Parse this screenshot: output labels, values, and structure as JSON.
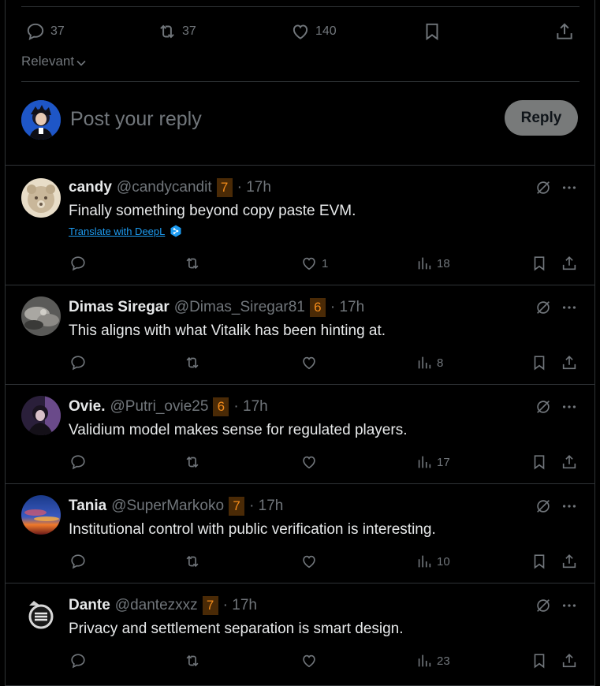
{
  "tweet_actions": {
    "reply_count": "37",
    "retweet_count": "37",
    "like_count": "140"
  },
  "sort": {
    "label": "Relevant"
  },
  "composer": {
    "placeholder": "Post your reply",
    "button_label": "Reply"
  },
  "replies": [
    {
      "name": "candy",
      "handle": "@candycandit",
      "badge": "7",
      "time": "· 17h",
      "text": "Finally something beyond copy paste EVM.",
      "translate": "Translate with DeepL",
      "likes": "1",
      "views": "18"
    },
    {
      "name": "Dimas Siregar",
      "handle": "@Dimas_Siregar81",
      "badge": "6",
      "time": "· 17h",
      "text": "This aligns with what Vitalik has been hinting at.",
      "likes": "",
      "views": "8"
    },
    {
      "name": "Ovie.",
      "handle": "@Putri_ovie25",
      "badge": "6",
      "time": "· 17h",
      "text": "Validium model makes sense for regulated players.",
      "likes": "",
      "views": "17"
    },
    {
      "name": "Tania",
      "handle": "@SuperMarkoko",
      "badge": "7",
      "time": "· 17h",
      "text": "Institutional control with public verification is interesting.",
      "likes": "",
      "views": "10"
    },
    {
      "name": "Dante",
      "handle": "@dantezxxz",
      "badge": "7",
      "time": "· 17h",
      "text": "Privacy and settlement separation is smart design.",
      "likes": "",
      "views": "23"
    }
  ],
  "colors": {
    "background": "#000000",
    "border": "#2f3336",
    "muted": "#71767b",
    "badge_bg": "#4a2a06",
    "badge_fg": "#f28b1a",
    "link": "#1d9bf0"
  }
}
